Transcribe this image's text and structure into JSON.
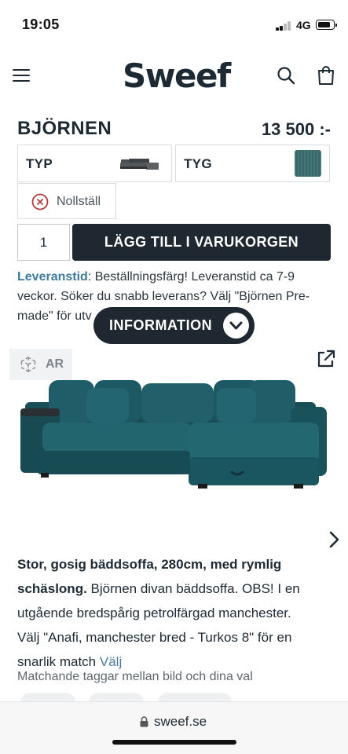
{
  "status_bar": {
    "time": "19:05",
    "network": "4G",
    "battery_icon": "battery-icon",
    "signal_icon": "signal-icon"
  },
  "header": {
    "logo": "Sweef",
    "icons": [
      "menu-icon",
      "search-icon",
      "cart-icon"
    ]
  },
  "product": {
    "title": "BJÖRNEN",
    "price": "13 500 :-",
    "options": [
      {
        "label": "TYP",
        "icon": "sofa-thumbnail-icon"
      },
      {
        "label": "TYG",
        "swatch_color": "#3a6d70"
      }
    ],
    "reset_label": "Nollställ",
    "quantity": "1",
    "add_to_cart_label": "LÄGG TILL I VARUKORGEN"
  },
  "delivery": {
    "label": "Leveranstid",
    "lines": [
      ": Beställningsfärg! Leveranstid ca 7-9",
      "veckor. Söker du snabb leverans? Välj \"Björnen Pre-",
      "made\" för utv"
    ]
  },
  "info_pill": {
    "label": "INFORMATION",
    "icon": "chevron-down-icon"
  },
  "gallery": {
    "ar_label": "AR",
    "icons": [
      "ar-cube-icon",
      "share-external-icon",
      "chevron-right-icon"
    ],
    "image": "teal-corduroy-corner-sofa"
  },
  "description": {
    "bold_lines": [
      "Stor, gosig bäddsoffa, 280cm, med rymlig",
      "schäslong."
    ],
    "line2_rest": " Björnen divan bäddsoffa. OBS! I en",
    "lines": [
      "utgående bredspårig petrolfärgad manchester.",
      "Välj \"Anafi, manchester bred - Turkos 8\" för en",
      "snarlik match "
    ],
    "more_label": "Välj"
  },
  "tags_caption": "Matchande taggar mellan bild och dina val",
  "browser": {
    "url": "sweef.se",
    "lock_icon": "lock-icon"
  },
  "colors": {
    "dark": "#1f2830",
    "accent_link": "#3d7a9e",
    "sofa_teal": "#1f5a64",
    "reset_red": "#b23a3a"
  }
}
